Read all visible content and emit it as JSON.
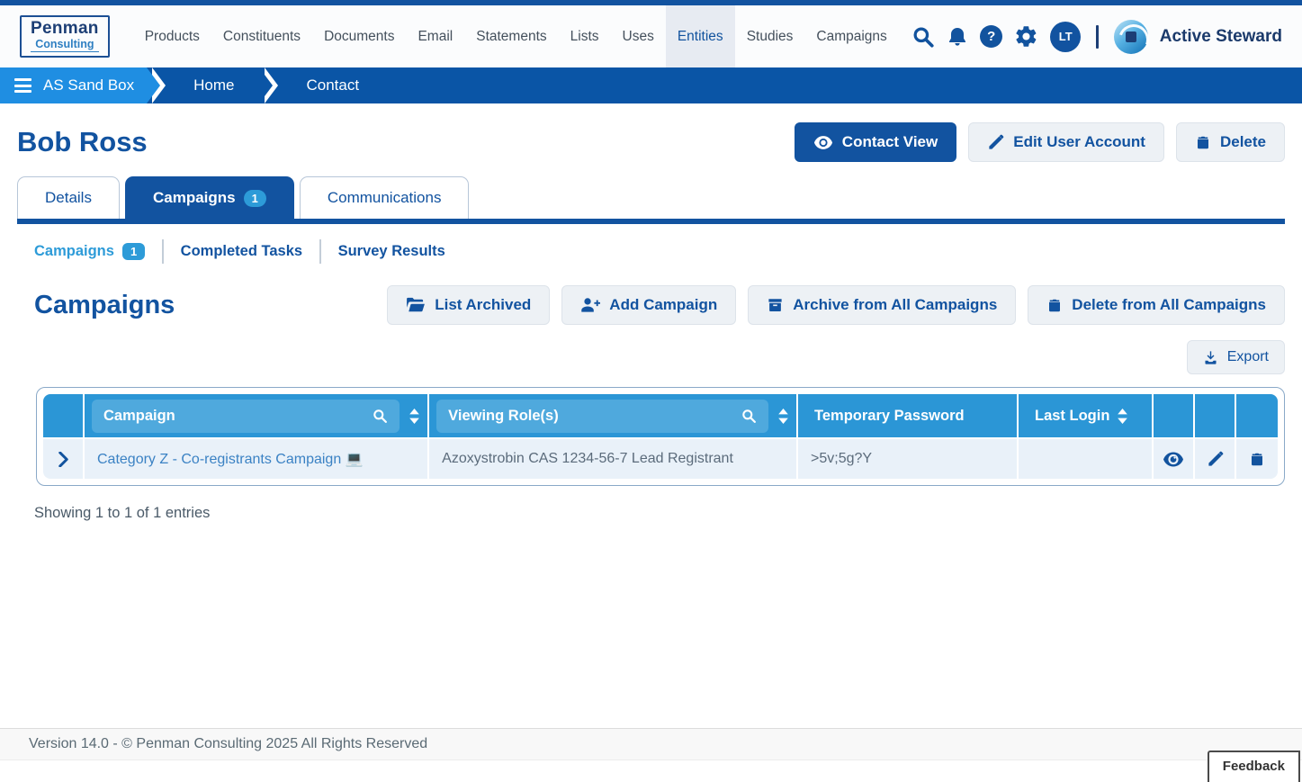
{
  "header": {
    "logo": {
      "line1": "Penman",
      "line2": "Consulting"
    },
    "nav": [
      {
        "label": "Products"
      },
      {
        "label": "Constituents"
      },
      {
        "label": "Documents"
      },
      {
        "label": "Email"
      },
      {
        "label": "Statements"
      },
      {
        "label": "Lists"
      },
      {
        "label": "Uses"
      },
      {
        "label": "Entities",
        "active": true
      },
      {
        "label": "Studies"
      },
      {
        "label": "Campaigns"
      }
    ],
    "avatar": "LT",
    "brand": "Active Steward"
  },
  "breadcrumb": {
    "items": [
      "AS Sand Box",
      "Home",
      "Contact"
    ]
  },
  "page": {
    "title": "Bob Ross",
    "buttons": {
      "contact_view": "Contact View",
      "edit_user": "Edit User Account",
      "delete": "Delete"
    }
  },
  "tabs": {
    "items": [
      {
        "label": "Details"
      },
      {
        "label": "Campaigns",
        "badge": "1",
        "active": true
      },
      {
        "label": "Communications"
      }
    ]
  },
  "subtabs": {
    "items": [
      {
        "label": "Campaigns",
        "badge": "1",
        "active": true
      },
      {
        "label": "Completed Tasks"
      },
      {
        "label": "Survey Results"
      }
    ]
  },
  "campaigns": {
    "heading": "Campaigns",
    "toolbar": {
      "list_archived": "List Archived",
      "add_campaign": "Add Campaign",
      "archive_all": "Archive from All Campaigns",
      "delete_all": "Delete from All Campaigns"
    },
    "export_label": "Export",
    "table": {
      "columns": {
        "campaign": "Campaign",
        "viewing_roles": "Viewing Role(s)",
        "temporary_password": "Temporary Password",
        "last_login": "Last Login"
      },
      "rows": [
        {
          "campaign": "Category Z - Co-registrants Campaign 💻",
          "viewing_roles": "Azoxystrobin CAS 1234-56-7 Lead Registrant",
          "temporary_password": ">5v;5g?Y",
          "last_login": ""
        }
      ]
    },
    "summary": "Showing 1 to 1 of 1 entries"
  },
  "footer": {
    "version": "Version 14.0 - © Penman Consulting 2025 All Rights Reserved",
    "feedback": "Feedback"
  },
  "colors": {
    "primary": "#1253a0",
    "table_header": "#2b96d6",
    "badge": "#2d9bd8",
    "breadcrumb_dark": "#0a55a6",
    "breadcrumb_light": "#1f8ee2",
    "link": "#3b82c4"
  }
}
